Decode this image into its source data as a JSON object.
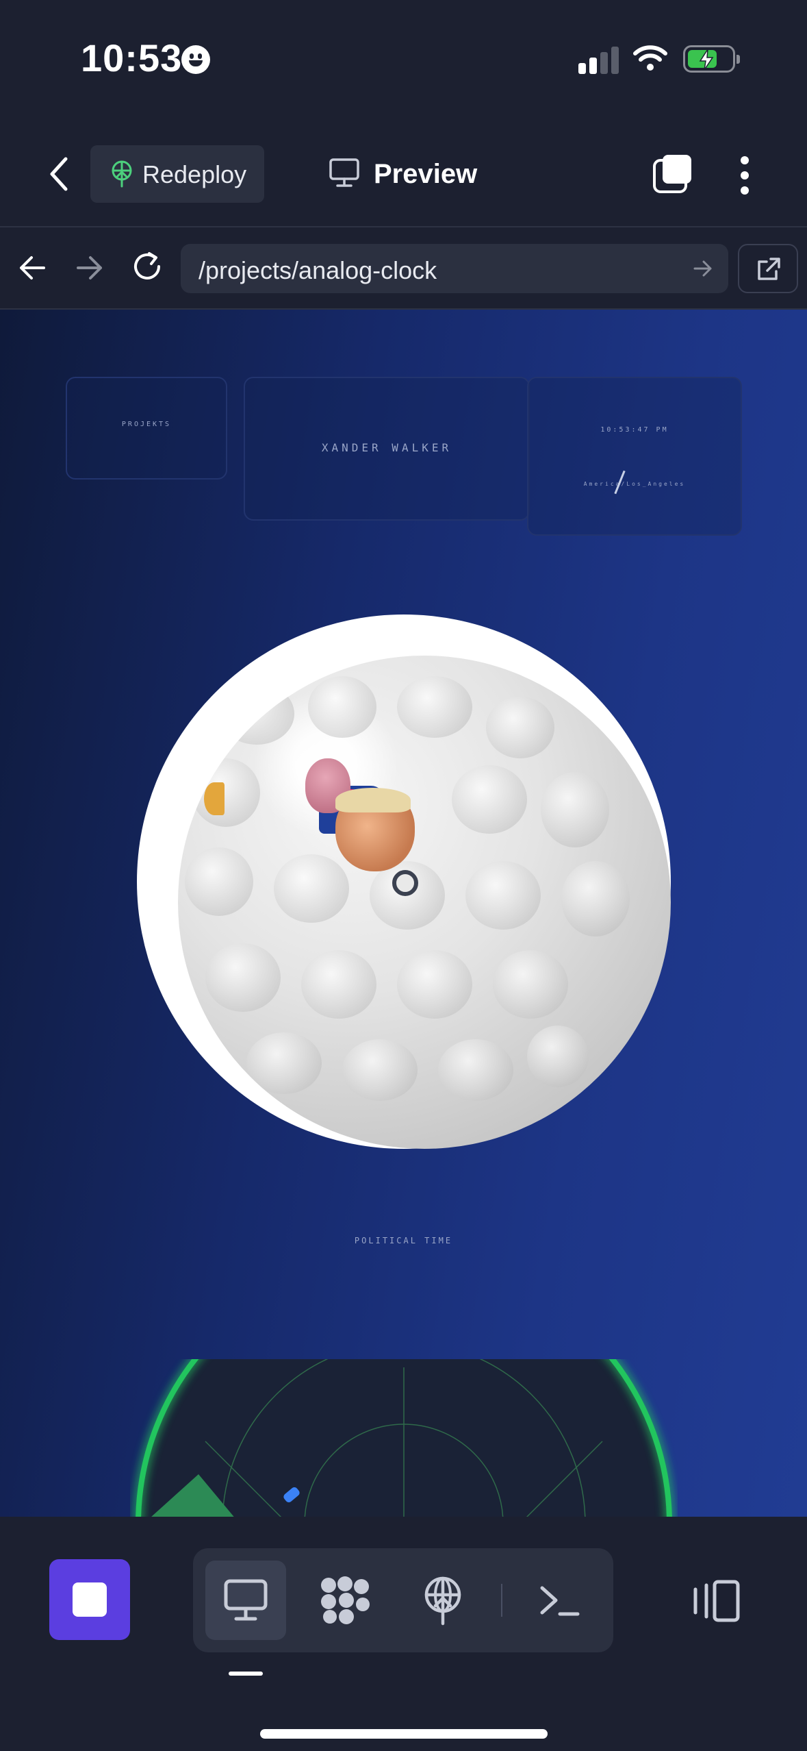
{
  "status_bar": {
    "time": "10:53",
    "battery_charging": true,
    "signal_bars": 2
  },
  "header": {
    "redeploy_label": "Redeploy",
    "preview_label": "Preview"
  },
  "browser": {
    "url": "/projects/analog-clock"
  },
  "page": {
    "projects_label": "PROJEKTS",
    "author_name": "XANDER WALKER",
    "clock_time": "10:53:47 PM",
    "timezone": "America/Los_Angeles",
    "caption": "POLITICAL TIME"
  },
  "toolbar": {
    "tabs": [
      {
        "name": "preview-tab",
        "icon": "monitor-icon",
        "active": true
      },
      {
        "name": "nodes-tab",
        "icon": "nodes-icon",
        "active": false
      },
      {
        "name": "deploy-tab",
        "icon": "deploy-icon",
        "active": false
      },
      {
        "name": "terminal-tab",
        "icon": "terminal-icon",
        "active": false
      }
    ]
  },
  "colors": {
    "accent": "#5b3ee0",
    "redeploy_icon": "#4cd07d",
    "radar_ring": "#22c55e",
    "page_bg": "#1c2030"
  }
}
